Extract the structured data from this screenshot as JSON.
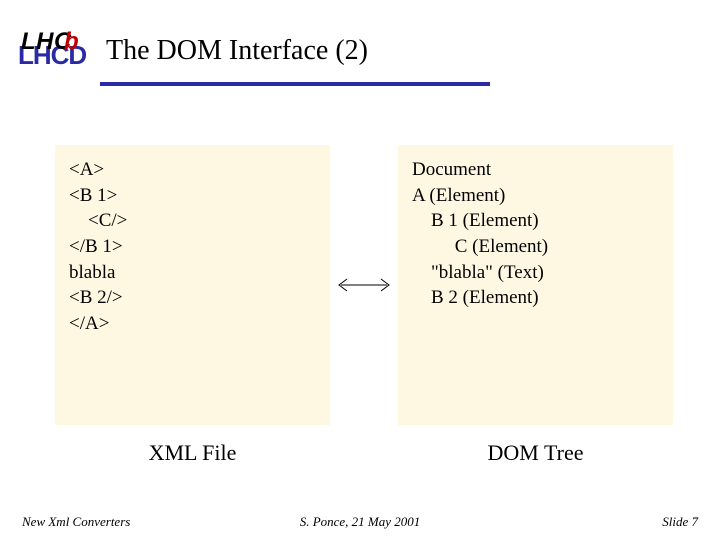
{
  "header": {
    "logo_back": "LHCD",
    "logo_front": "LHC",
    "logo_accent": "b",
    "title": "The DOM Interface (2)"
  },
  "xml_panel": {
    "content": "<A>\n<B 1>\n    <C/>\n</B 1>\nblabla\n<B 2/>\n</A>"
  },
  "dom_panel": {
    "content": "Document\nA (Element)\n    B 1 (Element)\n         C (Element)\n    \"blabla\" (Text)\n    B 2 (Element)"
  },
  "captions": {
    "left": "XML File",
    "right": "DOM Tree"
  },
  "footer": {
    "left": "New Xml Converters",
    "center": "S. Ponce, 21 May 2001",
    "right": "Slide 7"
  }
}
